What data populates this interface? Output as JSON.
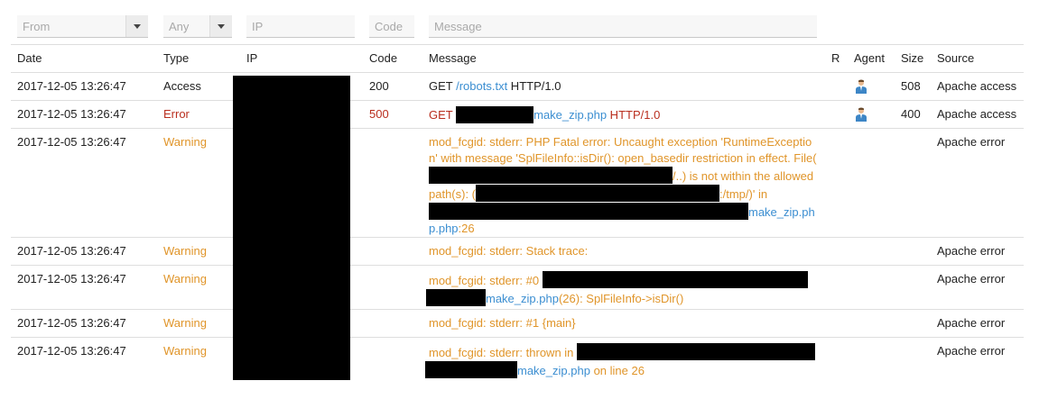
{
  "filters": {
    "from": "From",
    "type": "Any",
    "ip": "IP",
    "code": "Code",
    "message": "Message"
  },
  "columns": {
    "date": "Date",
    "type": "Type",
    "ip": "IP",
    "code": "Code",
    "message": "Message",
    "r": "R",
    "agent": "Agent",
    "size": "Size",
    "source": "Source"
  },
  "rows": [
    {
      "date": "2017-12-05 13:26:47",
      "type": "Access",
      "code": "200",
      "size": "508",
      "source": "Apache access",
      "msg": {
        "pre": "GET ",
        "link": "/robots.txt",
        "post": " HTTP/1.0"
      }
    },
    {
      "date": "2017-12-05 13:26:47",
      "type": "Error",
      "code": "500",
      "size": "400",
      "source": "Apache access",
      "msg": {
        "pre": "GET ",
        "link": "make_zip.php",
        "post": " HTTP/1.0"
      }
    },
    {
      "date": "2017-12-05 13:26:47",
      "type": "Warning",
      "code": "",
      "size": "",
      "source": "Apache error",
      "msg": {
        "a": "mod_fcgid: stderr: PHP Fatal error: Uncaught exception 'RuntimeException' with message 'SplFileInfo::isDir(): open_basedir restriction in effect. File(",
        "b": "/..) is not within the allowed path(s): (",
        "c": ":/tmp/)' in ",
        "link": "make_zip.php",
        "d": ":26"
      }
    },
    {
      "date": "2017-12-05 13:26:47",
      "type": "Warning",
      "code": "",
      "size": "",
      "source": "Apache error",
      "msg": {
        "text": "mod_fcgid: stderr: Stack trace:"
      }
    },
    {
      "date": "2017-12-05 13:26:47",
      "type": "Warning",
      "code": "",
      "size": "",
      "source": "Apache error",
      "msg": {
        "pre": "mod_fcgid: stderr: #0 ",
        "link": "make_zip.php",
        "post": "(26): SplFileInfo->isDir()"
      }
    },
    {
      "date": "2017-12-05 13:26:47",
      "type": "Warning",
      "code": "",
      "size": "",
      "source": "Apache error",
      "msg": {
        "text": "mod_fcgid: stderr: #1 {main}"
      }
    },
    {
      "date": "2017-12-05 13:26:47",
      "type": "Warning",
      "code": "",
      "size": "",
      "source": "Apache error",
      "msg": {
        "pre": "mod_fcgid: stderr: thrown in ",
        "link": "make_zip.php",
        "post": " on line 26"
      }
    }
  ],
  "colors": {
    "link": "#3b8ed1",
    "error": "#b92e1e",
    "warning": "#e0952a"
  },
  "icons": {
    "agent": "user-icon",
    "dropdown": "chevron-down-icon"
  }
}
